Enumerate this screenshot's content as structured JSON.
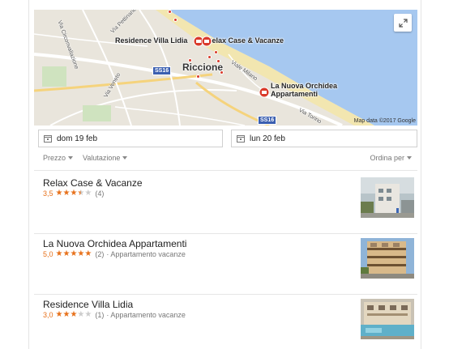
{
  "map": {
    "labels": {
      "hotel1": "Residence Villa Lidia",
      "hotel2": "Relax Case & Vacanze",
      "hotel3_line1": "La Nuova Orchidea",
      "hotel3_line2": "Appartamenti",
      "city": "Riccione",
      "street1": "Via Pettinarie",
      "street2": "Via Veneto",
      "street3": "Viale Milano",
      "street4": "Via Torino",
      "street5": "Via Circonvallazione"
    },
    "road_badges": [
      "SS16",
      "SS16"
    ],
    "attribution": "Map data ©2017 Google",
    "expand_icon": "expand-icon",
    "colors": {
      "sea": "#a6c8f0",
      "land": "#e9e5dc",
      "beach": "#f4e8b4",
      "marker": "#d93a2b"
    }
  },
  "dates": {
    "checkin": "dom 19 feb",
    "checkout": "lun 20 feb"
  },
  "filters": {
    "price": "Prezzo",
    "rating": "Valutazione",
    "sort": "Ordina per"
  },
  "results": [
    {
      "name": "Relax Case & Vacanze",
      "rating": "3,5",
      "stars": 3.5,
      "reviews": "(4)",
      "type": ""
    },
    {
      "name": "La Nuova Orchidea Appartamenti",
      "rating": "5,0",
      "stars": 5,
      "reviews": "(2)",
      "type": "· Appartamento vacanze"
    },
    {
      "name": "Residence Villa Lidia",
      "rating": "3,0",
      "stars": 3,
      "reviews": "(1)",
      "type": "· Appartamento vacanze"
    }
  ]
}
